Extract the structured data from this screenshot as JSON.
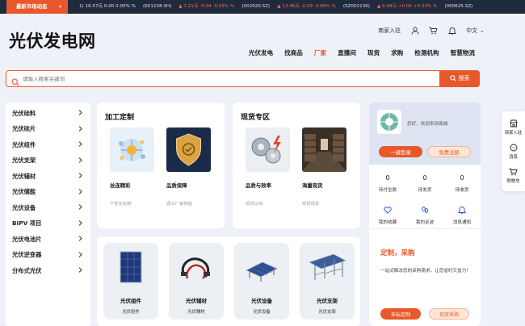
{
  "ticker": {
    "badge": "最新市场动态",
    "items": [
      {
        "text": "1)  16.57元 0.00 0.00% %",
        "tone": "dn"
      },
      {
        "text": "(601238.SH)",
        "tone": "dn"
      },
      {
        "text": "▲ 7.21元 -0.04 -0.55% %",
        "tone": "up"
      },
      {
        "text": "(002920.SZ)",
        "tone": "dn"
      },
      {
        "text": "▲ 13.46元 -0.09 -0.66% %",
        "tone": "up"
      },
      {
        "text": "(SZ002136)",
        "tone": "dn"
      },
      {
        "text": "▲ 9.09元 +0.03 +0.33% %",
        "tone": "up"
      },
      {
        "text": "(000625.SZ)",
        "tone": "dn"
      }
    ]
  },
  "header": {
    "logo": "光伏发电网",
    "merchant_link": "商家入驻",
    "language": "中文"
  },
  "nav": [
    {
      "label": "光伏发电",
      "active": false
    },
    {
      "label": "找商品",
      "active": false
    },
    {
      "label": "厂家",
      "active": true
    },
    {
      "label": "直播间",
      "active": false
    },
    {
      "label": "现货",
      "active": false
    },
    {
      "label": "求购",
      "active": false
    },
    {
      "label": "检测机构",
      "active": false
    },
    {
      "label": "智慧物流",
      "active": false
    }
  ],
  "search": {
    "placeholder": "请输入搜索关键词",
    "button": "搜索"
  },
  "categories": [
    "光伏硅料",
    "光伏硅片",
    "光伏组件",
    "光伏支架",
    "光伏辅材",
    "光伏储能",
    "光伏设备",
    "BIPV 项目",
    "光伏电池片",
    "光伏逆变器",
    "分布式光伏"
  ],
  "card_process": {
    "title": "加工定制",
    "items": [
      {
        "title": "丝连精彩",
        "sub": "个性化定制"
      },
      {
        "title": "品质保障",
        "sub": "源头厂家制造"
      }
    ]
  },
  "card_stock": {
    "title": "现货专区",
    "items": [
      {
        "title": "品质与效率",
        "sub": "现货以待"
      },
      {
        "title": "海量现货",
        "sub": "现货现发"
      }
    ]
  },
  "tiles": [
    {
      "title": "光伏组件",
      "sub": "光伏组件"
    },
    {
      "title": "光伏辅材",
      "sub": "光伏辅材"
    },
    {
      "title": "光伏设备",
      "sub": "光伏设备"
    },
    {
      "title": "光伏支架",
      "sub": "光伏支架"
    }
  ],
  "user_panel": {
    "greeting": "您好，欢迎来到商城",
    "login": "一键登录",
    "register": "免费注册",
    "stats": [
      {
        "n": "0",
        "label": "待付全款"
      },
      {
        "n": "0",
        "label": "待发货"
      },
      {
        "n": "0",
        "label": "待收货"
      }
    ],
    "quick": [
      {
        "label": "我的收藏"
      },
      {
        "label": "我的足迹"
      },
      {
        "label": "消息通知"
      }
    ],
    "promo_title": "定制，采购",
    "promo_desc": "一站式解决您的采购需求，让您省时又省力！",
    "btn_custom": "非标定制",
    "btn_buy": "现货采购"
  },
  "float": {
    "merchant": "商家入驻",
    "message": "消息",
    "cart": "购物车"
  },
  "colors": {
    "accent": "#e8582a",
    "ticker_bg": "#1f2a3c"
  }
}
